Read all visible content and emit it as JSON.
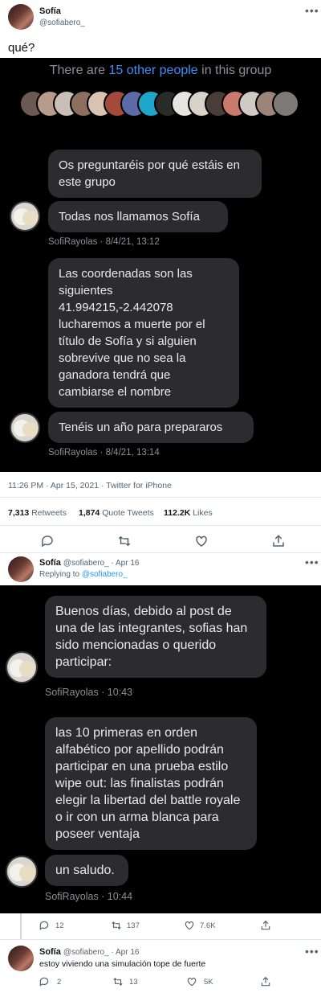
{
  "tweet1": {
    "name": "Sofía",
    "handle": "@sofiabero_",
    "text": "qué?",
    "more": "•••"
  },
  "screenshot1": {
    "group_prefix": "There are ",
    "group_highlight": "15 other people",
    "group_suffix": " in this group",
    "bubbles": [
      "Os preguntaréis por qué estáis en este grupo",
      "Todas nos llamamos Sofía",
      "Las coordenadas son las siguientes 41.994215,-2.442078 lucharemos a muerte por el título de Sofía y si alguien sobrevive que no sea la ganadora tendrá que cambiarse el nombre",
      "Tenéis un año para prepararos"
    ],
    "meta1": "SofiRayolas · 8/4/21, 13:12",
    "meta2": "SofiRayolas · 8/4/21, 13:14"
  },
  "tweet1_footer": {
    "timestamp": "11:26 PM · Apr 15, 2021 · Twitter for iPhone",
    "retweets_num": "7,313",
    "retweets_label": " Retweets",
    "quotes_num": "1,874",
    "quotes_label": " Quote Tweets",
    "likes_num": "112.2K",
    "likes_label": " Likes"
  },
  "reply1": {
    "name": "Sofía",
    "handle_date": "@sofiabero_ · Apr 16",
    "replying_prefix": "Replying to ",
    "replying_handle": "@sofiabero_",
    "more": "•••"
  },
  "screenshot2": {
    "bubbles": [
      "Buenos días, debido al post de una de las integrantes, sofias han sido mencionadas o querido participar:",
      "las 10 primeras en orden alfabético por apellido podrán participar en una prueba estilo wipe out: las finalistas podrán elegir la libertad del battle royale o ir con un arma blanca para poseer ventaja",
      "un saludo."
    ],
    "meta1": "SofiRayolas · 10:43",
    "meta2": "SofiRayolas · 10:44"
  },
  "reply1_actions": {
    "replies": "12",
    "retweets": "137",
    "likes": "7.6K"
  },
  "reply2": {
    "name": "Sofía",
    "handle_date": "@sofiabero_ · Apr 16",
    "text": "estoy viviendo una simulación tope de fuerte",
    "more": "•••",
    "replies": "2",
    "retweets": "13",
    "likes": "5K"
  },
  "colors": {
    "accent": "#1d9bf0",
    "highlight": "#3b8ff5",
    "bubble": "#2c2c2e"
  }
}
